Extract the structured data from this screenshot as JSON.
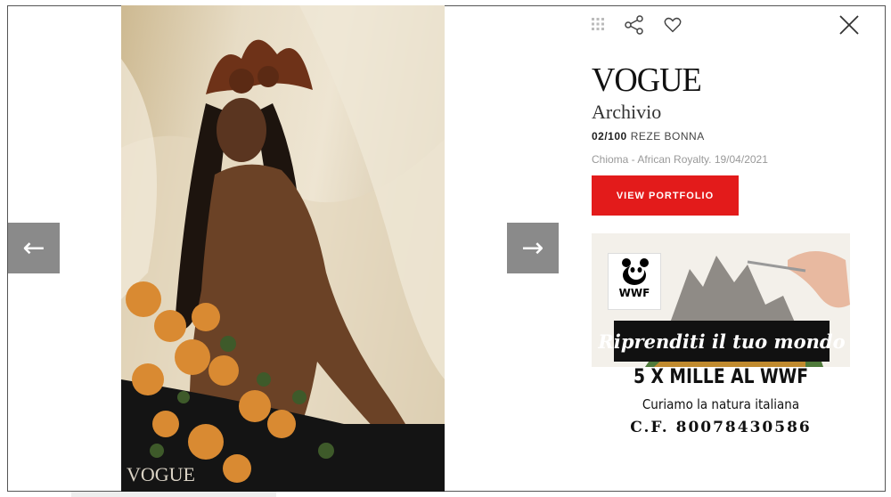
{
  "photo": {
    "watermark": "VOGUE"
  },
  "nav": {
    "prev_glyph": "←",
    "next_glyph": "→"
  },
  "toolbar": {
    "icons": [
      "grid-icon",
      "share-icon",
      "heart-icon",
      "close-icon"
    ]
  },
  "panel": {
    "brand": "VOGUE",
    "section": "Archivio",
    "counter": "02/100",
    "author": "REZE BONNA",
    "caption_title": "Chioma - African Royalty",
    "caption_date": "19/04/2021",
    "portfolio_button": "VIEW PORTFOLIO"
  },
  "ad": {
    "logo_text": "WWF",
    "tagline": "Riprenditi il tuo mondo",
    "line1": "5 X MILLE AL WWF",
    "line2": "Curiamo la natura italiana",
    "line3": "C.F. 80078430586"
  },
  "colors": {
    "accent": "#e31b1b",
    "arrow_bg": "#8a8a8a"
  }
}
